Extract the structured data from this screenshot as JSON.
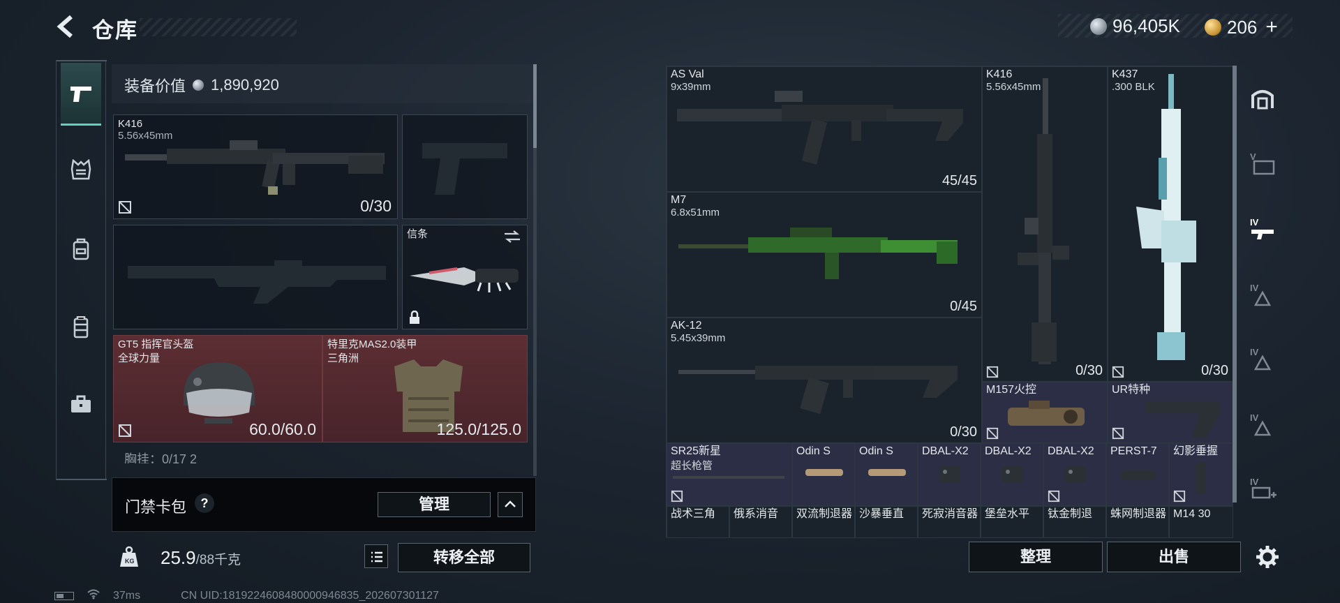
{
  "header": {
    "title": "仓库",
    "currency_silver": "96,405K",
    "currency_gold": "206",
    "add_label": "+"
  },
  "left_nav": {
    "tabs": [
      "weapon",
      "vest",
      "backpack",
      "armor",
      "case"
    ]
  },
  "loadout": {
    "equip_value_label": "装备价值",
    "equip_value": "1,890,920",
    "primary": {
      "name": "K416",
      "caliber": "5.56x45mm",
      "ammo": "0/30"
    },
    "melee": {
      "name": "信条"
    },
    "helmet": {
      "name": "GT5 指挥官头盔",
      "sub": "全球力量",
      "durability": "60.0/60.0"
    },
    "armor": {
      "name": "特里克MAS2.0装甲",
      "sub": "三角洲",
      "durability": "125.0/125.0"
    },
    "chest_rig_partial": "胸挂：0/17 2"
  },
  "card_pack": {
    "label": "门禁卡包",
    "help": "?",
    "manage_label": "管理"
  },
  "inventory_bar": {
    "weight": "25.9",
    "weight_max": "/88千克",
    "transfer_all_label": "转移全部"
  },
  "stash": {
    "weapons": [
      {
        "name": "AS Val",
        "caliber": "9x39mm",
        "ammo": "45/45"
      },
      {
        "name": "K416",
        "caliber": "5.56x45mm",
        "ammo": "0/30"
      },
      {
        "name": "K437",
        "caliber": ".300 BLK",
        "ammo": "0/30"
      },
      {
        "name": "M7",
        "caliber": "6.8x51mm",
        "ammo": "0/45"
      },
      {
        "name": "AK-12",
        "caliber": "5.45x39mm",
        "ammo": "0/30"
      }
    ],
    "parts_row1": [
      {
        "name": "M157火控"
      },
      {
        "name": "UR特种"
      }
    ],
    "parts_row2": [
      {
        "name": "SR25新星",
        "sub": "超长枪管"
      },
      {
        "name": "Odin S"
      },
      {
        "name": "Odin S"
      },
      {
        "name": "DBAL-X2"
      },
      {
        "name": "DBAL-X2"
      },
      {
        "name": "DBAL-X2"
      },
      {
        "name": "PERST-7"
      },
      {
        "name": "幻影垂握"
      }
    ],
    "parts_row3": [
      {
        "name": "战术三角"
      },
      {
        "name": "俄系消音"
      },
      {
        "name": "双流制退器"
      },
      {
        "name": "沙暴垂直"
      },
      {
        "name": "死寂消音器"
      },
      {
        "name": "堡垒水平"
      },
      {
        "name": "钛金制退"
      },
      {
        "name": "蛛网制退器"
      },
      {
        "name": "M14 30"
      }
    ],
    "sort_label": "整理",
    "sell_label": "出售"
  },
  "status_bar": {
    "ping": "37ms",
    "uid": "CN UID:18192246084800009468​35_202607301127"
  },
  "colors": {
    "accent": "#5fd2c4",
    "red_slot": "#5c2e33",
    "purple_slot": "#2c2e45"
  }
}
